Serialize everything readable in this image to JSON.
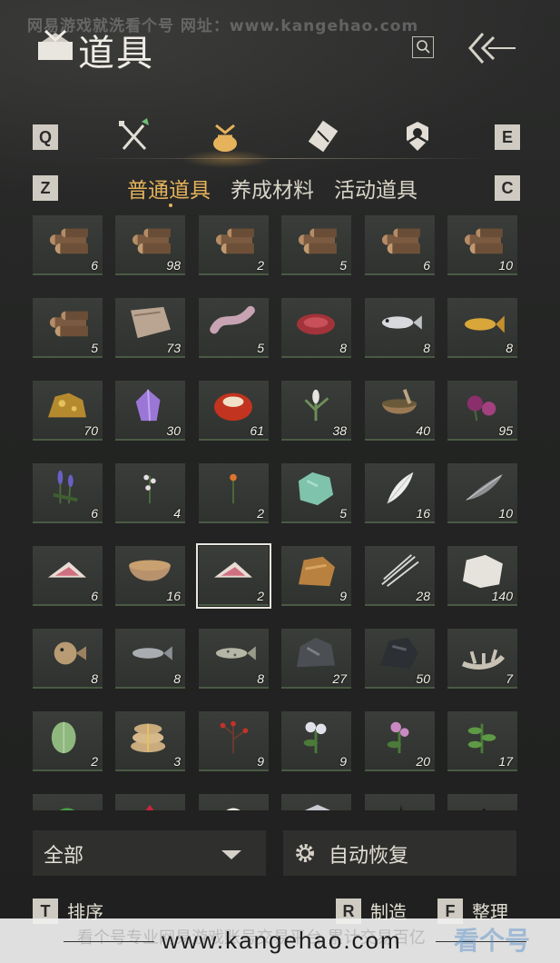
{
  "watermark": {
    "top_text": "网易游戏就洗看个号  网址：www.kangehao.com",
    "bottom_url": "www.kangehao.com",
    "bottom_faint": "看个号专业网易游戏账号交易平台 累计交易百亿",
    "logo_text": "看个号"
  },
  "header": {
    "title": "道具",
    "title_icon": "bag-emblem-icon",
    "search_icon": "search-icon",
    "back_icon": "double-chevron-left-icon"
  },
  "tabs": {
    "prev_key": "Q",
    "next_key": "E",
    "icons": [
      "crossed-swords-icon",
      "pouch-icon",
      "scroll-icon",
      "badge-icon"
    ],
    "active_index": 1
  },
  "subtabs": {
    "prev_key": "Z",
    "next_key": "C",
    "items": [
      "普通道具",
      "养成材料",
      "活动道具"
    ],
    "active_index": 0
  },
  "inventory": {
    "items": [
      {
        "icon": "wood-logs-icon",
        "count": "6"
      },
      {
        "icon": "wood-logs-icon",
        "count": "98"
      },
      {
        "icon": "wood-logs-icon",
        "count": "2"
      },
      {
        "icon": "wood-logs-icon",
        "count": "5"
      },
      {
        "icon": "wood-logs-icon",
        "count": "6"
      },
      {
        "icon": "wood-logs-icon",
        "count": "10"
      },
      {
        "icon": "wood-logs-icon",
        "count": "5"
      },
      {
        "icon": "hide-icon",
        "count": "73"
      },
      {
        "icon": "raw-meat-strip-icon",
        "count": "5"
      },
      {
        "icon": "steak-icon",
        "count": "8"
      },
      {
        "icon": "fish-icon",
        "count": "8"
      },
      {
        "icon": "golden-carp-icon",
        "count": "8"
      },
      {
        "icon": "gold-ore-icon",
        "count": "70"
      },
      {
        "icon": "amethyst-icon",
        "count": "30"
      },
      {
        "icon": "red-stone-icon",
        "count": "61"
      },
      {
        "icon": "herb-plant-icon",
        "count": "38"
      },
      {
        "icon": "mortar-bowl-icon",
        "count": "40"
      },
      {
        "icon": "purple-flower-icon",
        "count": "95"
      },
      {
        "icon": "lavender-icon",
        "count": "6"
      },
      {
        "icon": "white-flower-icon",
        "count": "4"
      },
      {
        "icon": "orange-flower-icon",
        "count": "2"
      },
      {
        "icon": "jade-stone-icon",
        "count": "5"
      },
      {
        "icon": "white-feather-icon",
        "count": "16"
      },
      {
        "icon": "dark-feather-icon",
        "count": "10"
      },
      {
        "icon": "meat-slice-icon",
        "count": "6"
      },
      {
        "icon": "soup-bowl-icon",
        "count": "16"
      },
      {
        "icon": "meat-slice-icon",
        "count": "2"
      },
      {
        "icon": "fur-pelt-icon",
        "count": "9"
      },
      {
        "icon": "quills-icon",
        "count": "28"
      },
      {
        "icon": "white-fleece-icon",
        "count": "140"
      },
      {
        "icon": "pufferfish-icon",
        "count": "8"
      },
      {
        "icon": "grey-fish-icon",
        "count": "8"
      },
      {
        "icon": "spotted-fish-icon",
        "count": "8"
      },
      {
        "icon": "iron-ore-icon",
        "count": "27"
      },
      {
        "icon": "dark-ore-icon",
        "count": "50"
      },
      {
        "icon": "bone-icon",
        "count": "7"
      },
      {
        "icon": "melon-icon",
        "count": "2"
      },
      {
        "icon": "grain-sacks-icon",
        "count": "3"
      },
      {
        "icon": "red-berry-branch-icon",
        "count": "9"
      },
      {
        "icon": "white-flower-plant-icon",
        "count": "9"
      },
      {
        "icon": "pink-flower-plant-icon",
        "count": "20"
      },
      {
        "icon": "green-herb-icon",
        "count": "17"
      },
      {
        "icon": "green-orb-icon",
        "count": ""
      },
      {
        "icon": "red-crystal-icon",
        "count": ""
      },
      {
        "icon": "white-blossom-icon",
        "count": ""
      },
      {
        "icon": "silver-ore-icon",
        "count": ""
      },
      {
        "icon": "black-shard-icon",
        "count": ""
      },
      {
        "icon": "black-fragment-icon",
        "count": ""
      }
    ],
    "selected_index": 26
  },
  "footer": {
    "filter_label": "全部",
    "auto_label": "自动恢复",
    "actions": [
      {
        "key": "T",
        "label": "排序"
      },
      {
        "key": "R",
        "label": "制造"
      },
      {
        "key": "F",
        "label": "整理"
      }
    ]
  }
}
